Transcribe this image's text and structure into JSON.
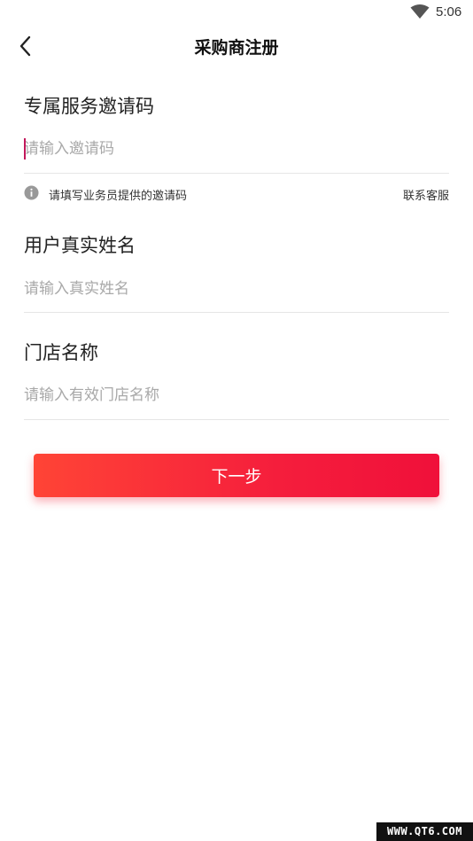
{
  "status_bar": {
    "time": "5:06",
    "wifi_icon": "wifi-icon"
  },
  "header": {
    "title": "采购商注册",
    "back_icon": "chevron-left-icon"
  },
  "form": {
    "invite_code": {
      "label": "专属服务邀请码",
      "placeholder": "请输入邀请码",
      "value": "",
      "hint": "请填写业务员提供的邀请码",
      "hint_icon": "info-icon",
      "contact_label": "联系客服"
    },
    "real_name": {
      "label": "用户真实姓名",
      "placeholder": "请输入真实姓名",
      "value": ""
    },
    "store_name": {
      "label": "门店名称",
      "placeholder": "请输入有效门店名称",
      "value": ""
    }
  },
  "next_button": {
    "label": "下一步"
  },
  "watermark": "WWW.QT6.COM",
  "colors": {
    "accent": "#f51e3c",
    "button_gradient_start": "#ff4436",
    "button_gradient_end": "#f0103a",
    "divider": "#e6e6e6",
    "placeholder": "#a9a9a9"
  }
}
